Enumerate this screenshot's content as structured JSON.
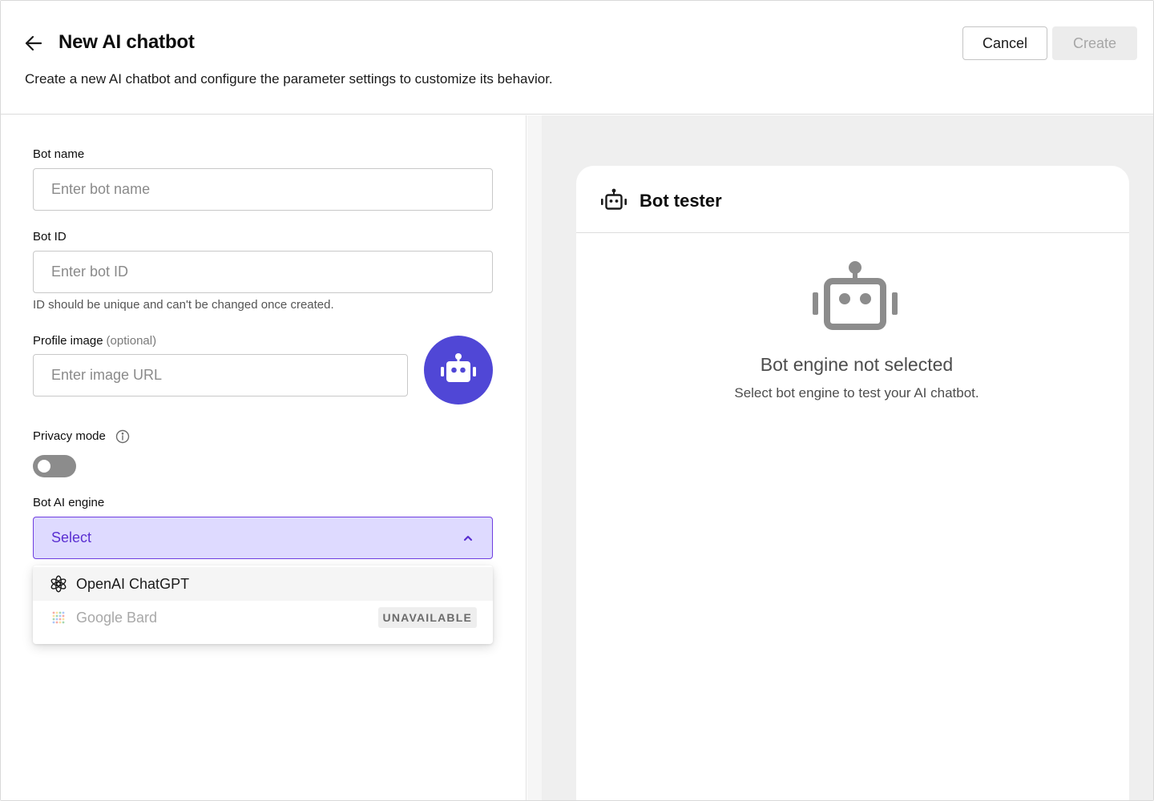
{
  "header": {
    "title": "New AI chatbot",
    "subtitle": "Create a new AI chatbot and configure the parameter settings to customize its behavior.",
    "back_icon": "arrow-left-icon",
    "cancel_label": "Cancel",
    "create_label": "Create",
    "create_disabled": true
  },
  "form": {
    "bot_name": {
      "label": "Bot name",
      "placeholder": "Enter bot name",
      "value": ""
    },
    "bot_id": {
      "label": "Bot ID",
      "placeholder": "Enter bot ID",
      "value": "",
      "helper": "ID should be unique and can't be changed once created."
    },
    "profile_image": {
      "label": "Profile image",
      "optional": "(optional)",
      "placeholder": "Enter image URL",
      "value": "",
      "avatar_icon": "robot-icon",
      "avatar_color": "#5047D6"
    },
    "privacy_mode": {
      "label": "Privacy mode",
      "info_icon": "info-icon",
      "enabled": false
    },
    "engine": {
      "label": "Bot AI engine",
      "selected": "Select",
      "open": true,
      "accent_color": "#6F3EE0",
      "options": [
        {
          "label": "OpenAI ChatGPT",
          "icon": "openai-icon",
          "available": true
        },
        {
          "label": "Google Bard",
          "icon": "bard-icon",
          "available": false,
          "badge": "UNAVAILABLE"
        }
      ]
    }
  },
  "tester": {
    "title": "Bot tester",
    "icon": "robot-icon",
    "empty_title": "Bot engine not selected",
    "empty_subtitle": "Select bot engine to test your AI chatbot."
  }
}
